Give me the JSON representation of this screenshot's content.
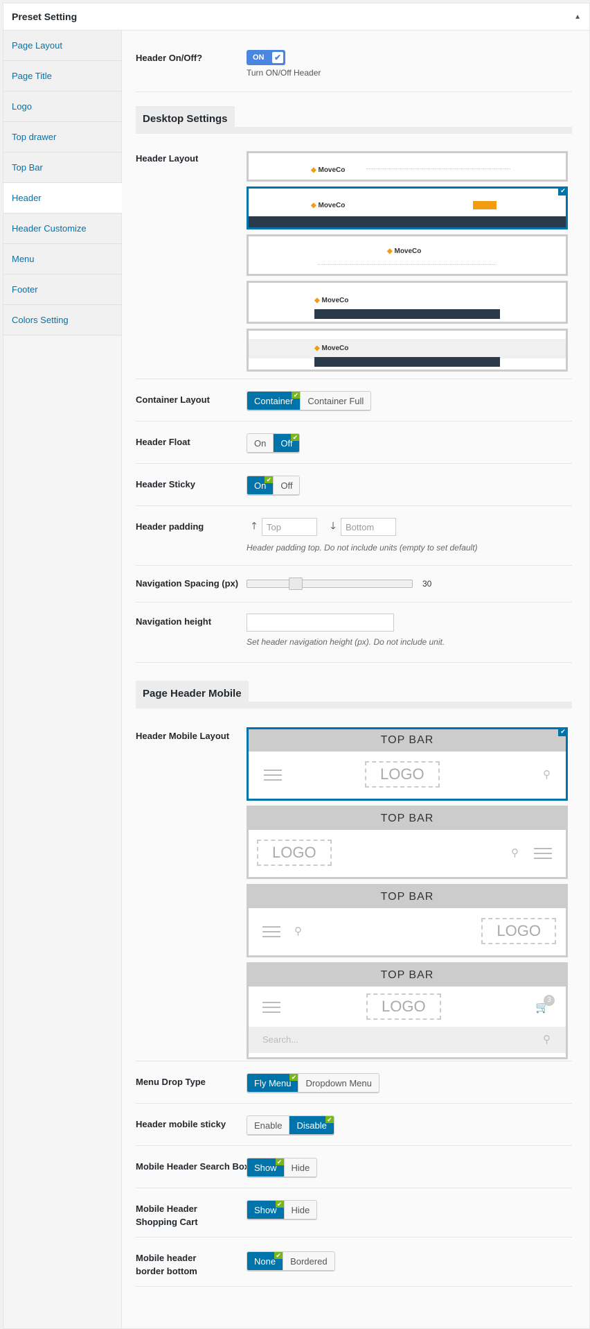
{
  "panel": {
    "title": "Preset Setting"
  },
  "sidebar": {
    "items": [
      {
        "label": "Page Layout"
      },
      {
        "label": "Page Title"
      },
      {
        "label": "Logo"
      },
      {
        "label": "Top drawer"
      },
      {
        "label": "Top Bar"
      },
      {
        "label": "Header"
      },
      {
        "label": "Header Customize"
      },
      {
        "label": "Menu"
      },
      {
        "label": "Footer"
      },
      {
        "label": "Colors Setting"
      }
    ]
  },
  "fields": {
    "header_onoff": {
      "label": "Header On/Off?",
      "toggle": "ON",
      "desc": "Turn ON/Off Header"
    },
    "desktop_section": "Desktop Settings",
    "header_layout": {
      "label": "Header Layout",
      "thumbs": [
        {
          "brand": "MoveCo"
        },
        {
          "brand": "MoveCo"
        },
        {
          "brand": "MoveCo"
        },
        {
          "brand": "MoveCo"
        },
        {
          "brand": "MoveCo"
        }
      ]
    },
    "container_layout": {
      "label": "Container Layout",
      "opt1": "Container",
      "opt2": "Container Full"
    },
    "header_float": {
      "label": "Header Float",
      "opt1": "On",
      "opt2": "Off"
    },
    "header_sticky": {
      "label": "Header Sticky",
      "opt1": "On",
      "opt2": "Off"
    },
    "header_padding": {
      "label": "Header padding",
      "top_placeholder": "Top",
      "bottom_placeholder": "Bottom",
      "desc": "Header padding top. Do not include units (empty to set default)"
    },
    "nav_spacing": {
      "label": "Navigation Spacing (px)",
      "value": "30",
      "fraction": 0.25
    },
    "nav_height": {
      "label": "Navigation height",
      "desc": "Set header navigation height (px). Do not include unit."
    },
    "mobile_section": "Page Header Mobile",
    "mobile_layout": {
      "label": "Header Mobile Layout",
      "topbar": "TOP   BAR",
      "logo": "LOGO",
      "search_placeholder": "Search...",
      "cart_count": "3"
    },
    "menu_drop": {
      "label": "Menu Drop Type",
      "opt1": "Fly Menu",
      "opt2": "Dropdown Menu"
    },
    "mobile_sticky": {
      "label": "Header mobile sticky",
      "opt1": "Enable",
      "opt2": "Disable"
    },
    "mobile_search": {
      "label": "Mobile Header Search Box",
      "opt1": "Show",
      "opt2": "Hide"
    },
    "mobile_cart": {
      "label": "Mobile Header Shopping Cart",
      "opt1": "Show",
      "opt2": "Hide"
    },
    "mobile_border": {
      "label": "Mobile header border bottom",
      "opt1": "None",
      "opt2": "Bordered"
    }
  },
  "colors": {
    "accent": "#0073aa",
    "check": "#7ab51d",
    "toggle": "#4a86e0"
  }
}
